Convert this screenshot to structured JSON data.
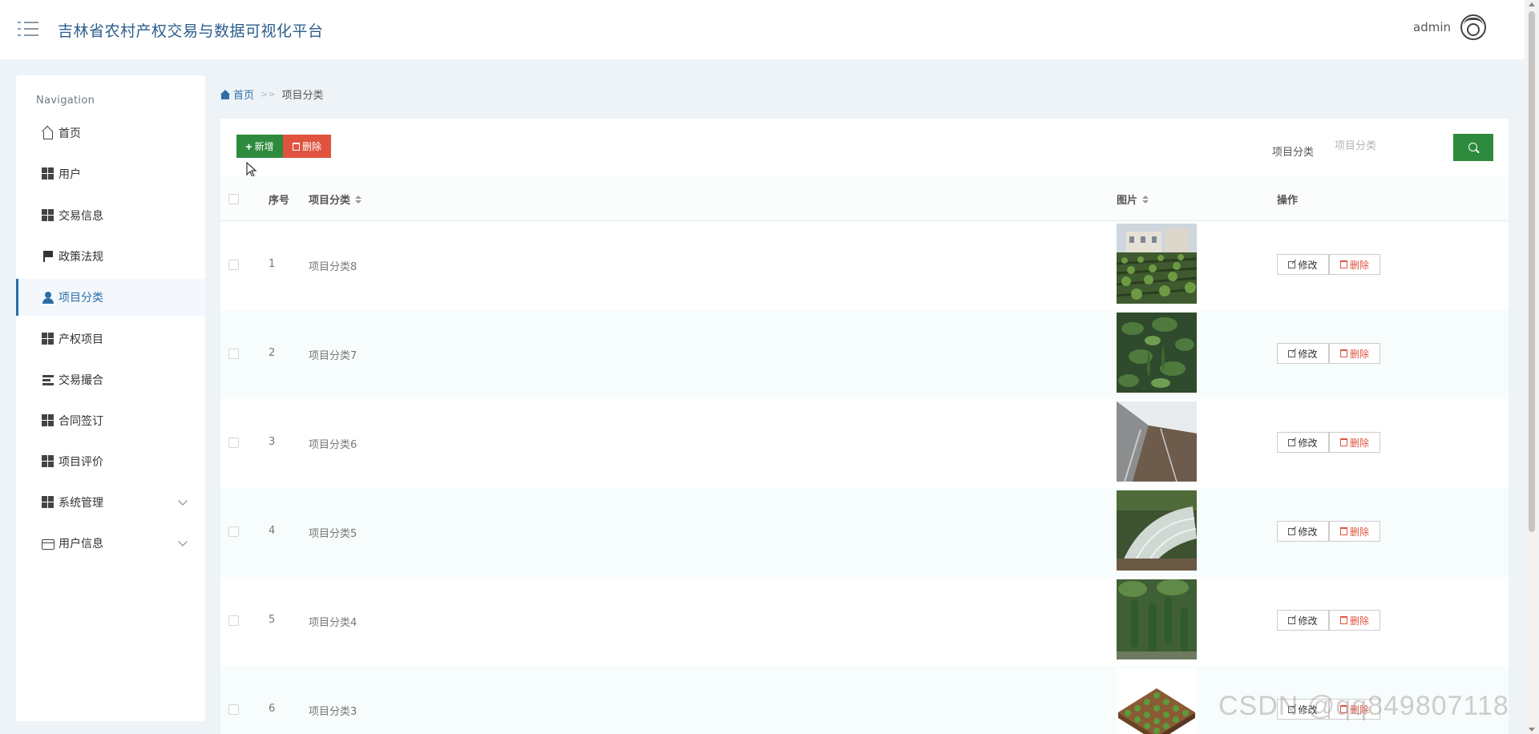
{
  "header": {
    "title": "吉林省农村产权交易与数据可视化平台",
    "username": "admin"
  },
  "sidebar": {
    "nav_title": "Navigation",
    "items": [
      {
        "label": "首页",
        "icon": "home-icon"
      },
      {
        "label": "用户",
        "icon": "grid-icon"
      },
      {
        "label": "交易信息",
        "icon": "grid-icon"
      },
      {
        "label": "政策法规",
        "icon": "flag-icon"
      },
      {
        "label": "项目分类",
        "icon": "user-icon",
        "active": true
      },
      {
        "label": "产权项目",
        "icon": "grid-icon"
      },
      {
        "label": "交易撮合",
        "icon": "tasks-icon"
      },
      {
        "label": "合同签订",
        "icon": "grid-icon"
      },
      {
        "label": "项目评价",
        "icon": "grid-icon"
      },
      {
        "label": "系统管理",
        "icon": "grid-icon",
        "expandable": true
      },
      {
        "label": "用户信息",
        "icon": "card-icon",
        "expandable": true
      }
    ]
  },
  "breadcrumb": {
    "home": "首页",
    "separator": ">>",
    "current": "项目分类"
  },
  "toolbar": {
    "add_label": "新增",
    "delete_label": "删除",
    "search_label": "项目分类",
    "search_placeholder": "项目分类"
  },
  "table": {
    "headers": {
      "index": "序号",
      "category": "项目分类",
      "image": "图片",
      "actions": "操作"
    },
    "edit_label": "修改",
    "delete_label": "删除",
    "rows": [
      {
        "index": "1",
        "category": "项目分类8",
        "image": "vegetable-garden"
      },
      {
        "index": "2",
        "category": "项目分类7",
        "image": "pepper-plants"
      },
      {
        "index": "3",
        "category": "项目分类6",
        "image": "greenhouse-film"
      },
      {
        "index": "4",
        "category": "项目分类5",
        "image": "plastic-tunnel"
      },
      {
        "index": "5",
        "category": "项目分类4",
        "image": "hanging-gourds"
      },
      {
        "index": "6",
        "category": "项目分类3",
        "image": "seedling-tray"
      }
    ]
  },
  "watermark": "CSDN @qq849807118",
  "colors": {
    "accent": "#2b6ea8",
    "green": "#2e8b3e",
    "red": "#e0533f"
  }
}
